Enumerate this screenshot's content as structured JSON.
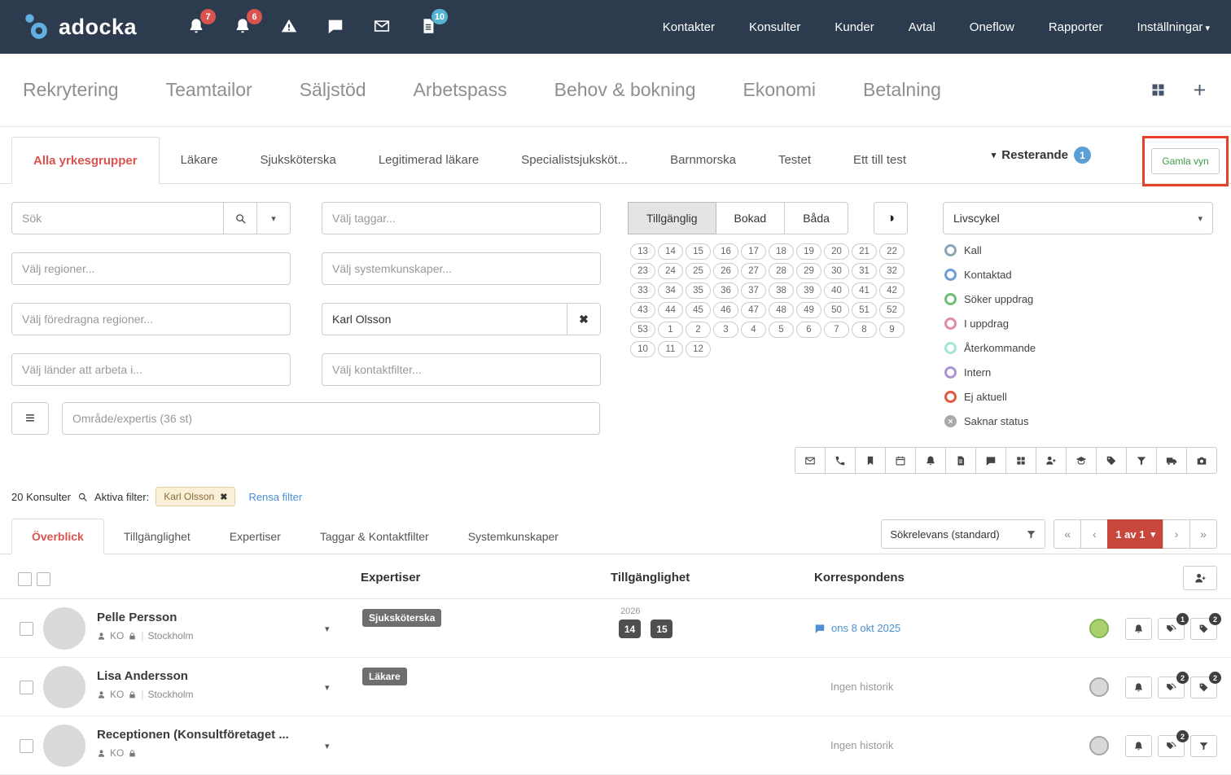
{
  "topbar": {
    "brand": "adocka",
    "notif": {
      "bell1_badge": "7",
      "bell2_badge": "6",
      "doc_badge": "10"
    },
    "nav": [
      {
        "label": "Kontakter"
      },
      {
        "label": "Konsulter"
      },
      {
        "label": "Kunder"
      },
      {
        "label": "Avtal"
      },
      {
        "label": "Oneflow"
      },
      {
        "label": "Rapporter"
      },
      {
        "label": "Inställningar",
        "caret": true
      }
    ]
  },
  "modules": {
    "items": [
      {
        "label": "Rekrytering"
      },
      {
        "label": "Teamtailor"
      },
      {
        "label": "Säljstöd"
      },
      {
        "label": "Arbetspass"
      },
      {
        "label": "Behov & bokning"
      },
      {
        "label": "Ekonomi"
      },
      {
        "label": "Betalning"
      }
    ]
  },
  "group_tabs": {
    "items": [
      {
        "label": "Alla yrkesgrupper",
        "active": true
      },
      {
        "label": "Läkare"
      },
      {
        "label": "Sjuksköterska"
      },
      {
        "label": "Legitimerad läkare"
      },
      {
        "label": "Specialistsjuksköt..."
      },
      {
        "label": "Barnmorska"
      },
      {
        "label": "Testet"
      },
      {
        "label": "Ett till test"
      }
    ],
    "resterande_label": "Resterande",
    "resterande_badge": "1",
    "old_view_label": "Gamla vyn"
  },
  "filters": {
    "search_placeholder": "Sök",
    "regions_placeholder": "Välj regioner...",
    "preferred_regions_placeholder": "Välj föredragna regioner...",
    "countries_placeholder": "Välj länder att arbeta i...",
    "tags_placeholder": "Välj taggar...",
    "system_skills_placeholder": "Välj systemkunskaper...",
    "consultant_value": "Karl Olsson",
    "contact_filter_placeholder": "Välj kontaktfilter...",
    "area_placeholder": "Område/expertis (36 st)",
    "availability_options": [
      {
        "label": "Tillgänglig",
        "active": true
      },
      {
        "label": "Bokad"
      },
      {
        "label": "Båda"
      }
    ],
    "weeks": [
      "13",
      "14",
      "15",
      "16",
      "17",
      "18",
      "19",
      "20",
      "21",
      "22",
      "23",
      "24",
      "25",
      "26",
      "27",
      "28",
      "29",
      "30",
      "31",
      "32",
      "33",
      "34",
      "35",
      "36",
      "37",
      "38",
      "39",
      "40",
      "41",
      "42",
      "43",
      "44",
      "45",
      "46",
      "47",
      "48",
      "49",
      "50",
      "51",
      "52",
      "53",
      "1",
      "2",
      "3",
      "4",
      "5",
      "6",
      "7",
      "8",
      "9",
      "10",
      "11",
      "12"
    ],
    "lifecycle_label": "Livscykel",
    "statuses": [
      {
        "label": "Kall",
        "color": "#8fa6b2"
      },
      {
        "label": "Kontaktad",
        "color": "#6c9fd8"
      },
      {
        "label": "Söker uppdrag",
        "color": "#6fbf73"
      },
      {
        "label": "I uppdrag",
        "color": "#e289ad"
      },
      {
        "label": "Återkommande",
        "color": "#a8e4dc"
      },
      {
        "label": "Intern",
        "color": "#ab94d6"
      },
      {
        "label": "Ej aktuell",
        "color": "#e2593f"
      },
      {
        "label": "Saknar status",
        "color": "#a9a9a9",
        "cross": true
      }
    ],
    "toolbar_icons": [
      "envelope",
      "phone",
      "bookmark",
      "calendar",
      "bell",
      "document",
      "chat",
      "grid",
      "person-add",
      "graduation-cap",
      "tag",
      "filter",
      "truck",
      "camera"
    ]
  },
  "results": {
    "count_label": "20 Konsulter",
    "active_filters_label": "Aktiva filter:",
    "filter_chip": "Karl Olsson",
    "clear_label": "Rensa filter",
    "tabs": [
      {
        "label": "Överblick",
        "active": true
      },
      {
        "label": "Tillgänglighet"
      },
      {
        "label": "Expertiser"
      },
      {
        "label": "Taggar & Kontaktfilter"
      },
      {
        "label": "Systemkunskaper"
      }
    ],
    "sort_label": "Sökrelevans (standard)",
    "page_label": "1 av 1",
    "columns": {
      "expertise": "Expertiser",
      "availability": "Tillgänglighet",
      "correspondence": "Korrespondens"
    },
    "rows": [
      {
        "name": "Pelle Persson",
        "org": "KO",
        "location": "Stockholm",
        "expertise": "Sjuksköterska",
        "availability_year": "2026",
        "availability_weeks": [
          "14",
          "15"
        ],
        "correspondence": "ons 8 okt 2025",
        "status_color": "#a9d16d",
        "status_border": "#83b557",
        "badge1": "1",
        "badge2": "2"
      },
      {
        "name": "Lisa Andersson",
        "org": "KO",
        "location": "Stockholm",
        "expertise": "Läkare",
        "correspondence": "Ingen historik",
        "status_color": "#d8d8d8",
        "status_border": "#a6a6a6",
        "badge1": "2",
        "badge2": "2"
      },
      {
        "name": "Receptionen (Konsultföretaget ...",
        "org": "KO",
        "correspondence": "Ingen historik",
        "status_color": "#d8d8d8",
        "status_border": "#a6a6a6",
        "badge1": "2"
      }
    ]
  }
}
